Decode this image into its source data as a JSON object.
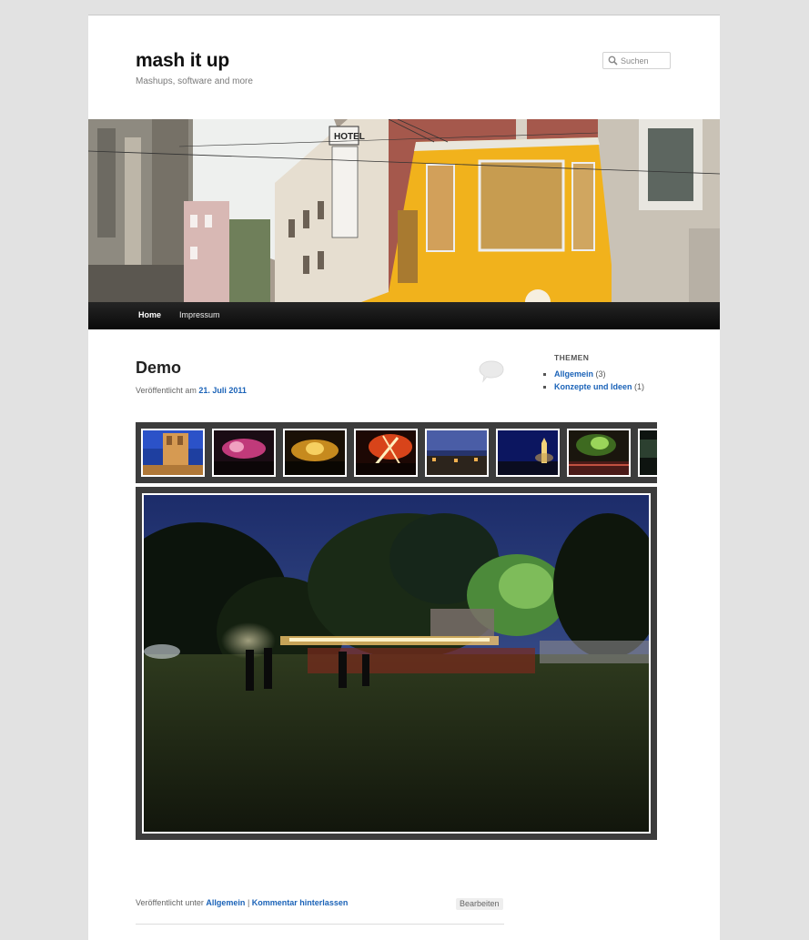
{
  "site": {
    "title": "mash it up",
    "description": "Mashups, software and more"
  },
  "search": {
    "placeholder": "Suchen"
  },
  "nav": {
    "items": [
      {
        "label": "Home"
      },
      {
        "label": "Impressum"
      }
    ]
  },
  "post": {
    "title": "Demo",
    "published_prefix": "Veröffentlicht am",
    "published_date": "21. Juli 2011",
    "footer_prefix": "Veröffentlicht unter",
    "category": "Allgemein",
    "separator": "|",
    "comment_link": "Kommentar hinterlassen",
    "edit_label": "Bearbeiten"
  },
  "sidebar": {
    "title": "THEMEN",
    "categories": [
      {
        "name": "Allgemein",
        "count": "(3)"
      },
      {
        "name": "Konzepte und Ideen",
        "count": "(1)"
      }
    ]
  },
  "gallery": {
    "thumbnails": [
      "church-tower-photo",
      "concert-pink-lights-photo",
      "concert-yellow-lights-photo",
      "concert-red-lights-photo",
      "town-at-dusk-photo",
      "illuminated-tower-night-photo",
      "park-green-light-photo",
      "partial-next-photo"
    ],
    "main_image": "night-park-light-trail-photo"
  },
  "colors": {
    "link": "#1b63b8",
    "nav_bg": "#1a1a1a",
    "gallery_frame": "#3c3c3c",
    "page_bg": "#e2e2e2",
    "tram_yellow": "#f1b21c"
  }
}
